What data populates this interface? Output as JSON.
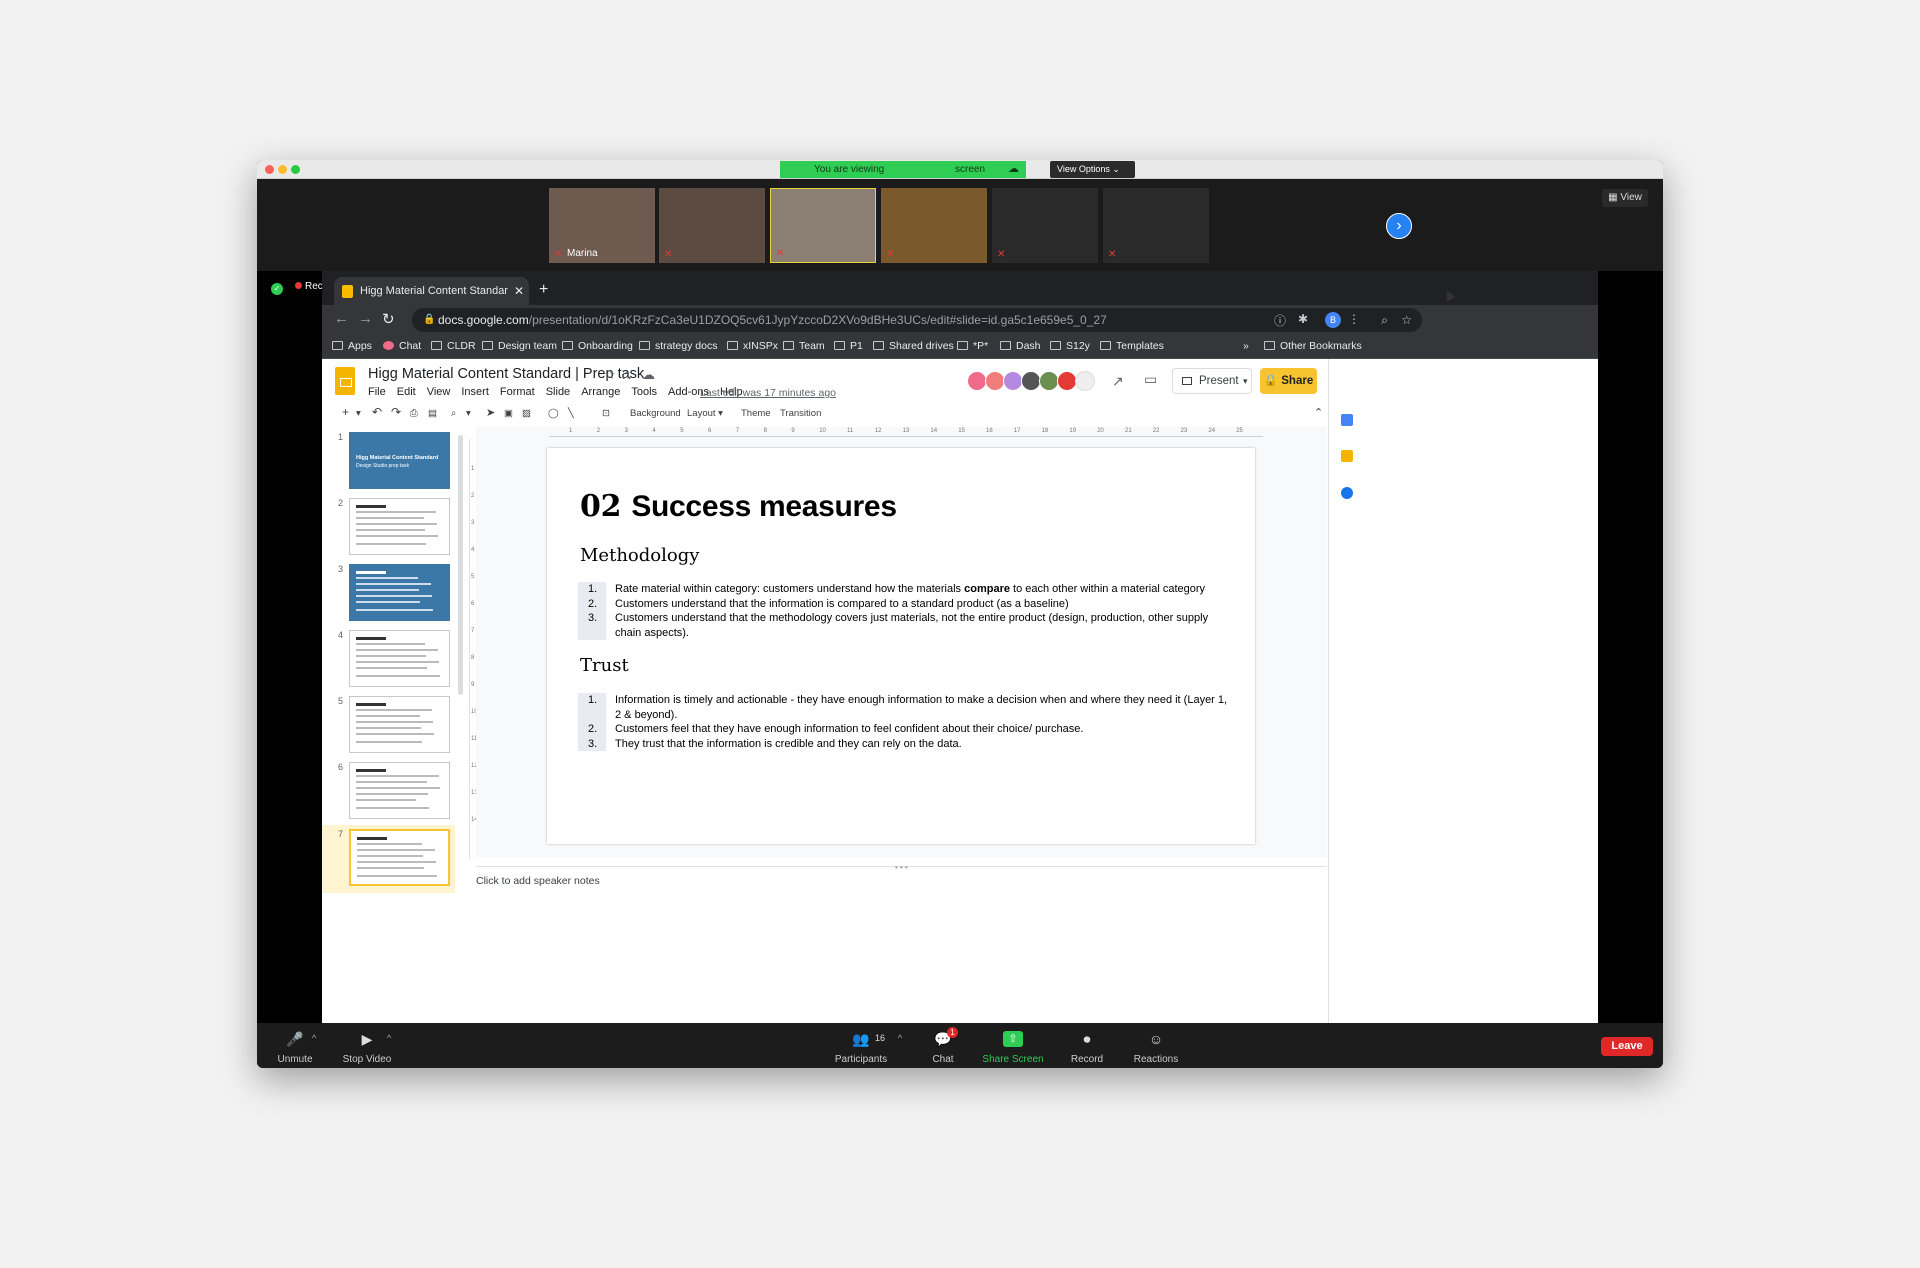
{
  "zoom": {
    "viewing_prefix": "You are viewing",
    "viewing_suffix": "screen",
    "view_options": "View Options ⌄",
    "view_btn": "View",
    "participants_tiles": [
      {
        "name": "Marina",
        "color": "#6e5a4f"
      },
      {
        "name": "",
        "color": "#5c4b40"
      },
      {
        "name": "",
        "color": "#8a7f72"
      },
      {
        "name": "",
        "color": "#7a5a2c"
      },
      {
        "name": "",
        "color": "#2a2a2a"
      },
      {
        "name": "",
        "color": "#2a2a2a"
      }
    ],
    "recording": "Recording",
    "toolbar": {
      "unmute": "Unmute",
      "stop_video": "Stop Video",
      "participants": "Participants",
      "participants_count": "16",
      "chat": "Chat",
      "chat_badge": "1",
      "share_screen": "Share Screen",
      "record": "Record",
      "reactions": "Reactions",
      "leave": "Leave"
    }
  },
  "browser": {
    "tab_title": "Higg Material Content Standar",
    "url_host": "docs.google.com",
    "url_path": "/presentation/d/1oKRzFzCa3eU1DZOQ5cv61JypYzccoD2XVo9dBHe3UCs/edit#slide=id.ga5c1e659e5_0_27",
    "bookmarks": [
      "Apps",
      "Chat",
      "CLDR",
      "Design team",
      "Onboarding",
      "strategy docs",
      "xINSPx",
      "Team",
      "P1",
      "Shared drives",
      "*P*",
      "Dash",
      "S12y",
      "Templates"
    ],
    "other_bookmarks": "Other Bookmarks",
    "more": "»",
    "profile_initial": "B"
  },
  "slides": {
    "title": "Higg Material Content Standard | Prep task",
    "menus": [
      "File",
      "Edit",
      "View",
      "Insert",
      "Format",
      "Slide",
      "Arrange",
      "Tools",
      "Add-ons",
      "Help"
    ],
    "last_edit": "Last edit was 17 minutes ago",
    "present": "Present",
    "share": "Share",
    "user_initial": "B",
    "toolbar": {
      "background": "Background",
      "layout": "Layout ▾",
      "theme": "Theme",
      "transition": "Transition"
    },
    "thumb_numbers": [
      "1",
      "2",
      "3",
      "4",
      "5",
      "6",
      "7"
    ],
    "thumb1_title": "Higg Material Content Standard",
    "thumb1_sub": "Design Studio prep task",
    "notes_placeholder": "Click to add speaker notes",
    "ruler_labels": [
      "1",
      "2",
      "3",
      "4",
      "5",
      "6",
      "7",
      "8",
      "9",
      "10",
      "11",
      "12",
      "13",
      "14",
      "15",
      "16",
      "17",
      "18",
      "19",
      "20",
      "21",
      "22",
      "23",
      "24",
      "25"
    ],
    "current_slide": {
      "title_num": "02",
      "title_text": "Success measures",
      "sections": [
        {
          "heading": "Methodology",
          "items": [
            {
              "n": "1.",
              "before": "Rate material within category: customers understand how the materials ",
              "bold": "compare",
              "after": " to each other within a material category"
            },
            {
              "n": "2.",
              "before": "Customers understand that the information is compared to a standard product (as a baseline)",
              "bold": "",
              "after": ""
            },
            {
              "n": "3.",
              "before": "Customers understand that the methodology covers just materials, not the entire product (design, production, other supply chain aspects).",
              "bold": "",
              "after": ""
            }
          ]
        },
        {
          "heading": "Trust",
          "items": [
            {
              "n": "1.",
              "before": "Information is timely and actionable - they have enough information to make a decision when and where they need it (Layer 1, 2 & beyond).",
              "bold": "",
              "after": ""
            },
            {
              "n": "2.",
              "before": "Customers feel that they have enough information to feel confident about their choice/ purchase.",
              "bold": "",
              "after": ""
            },
            {
              "n": "3.",
              "before": "They trust that the information is credible and they can rely on the data.",
              "bold": "",
              "after": ""
            }
          ]
        }
      ]
    }
  },
  "colors": {
    "zoom_green": "#2fcd53",
    "docs_yellow": "#f4b400",
    "leave_red": "#e02828",
    "chrome_dark": "#202124"
  }
}
